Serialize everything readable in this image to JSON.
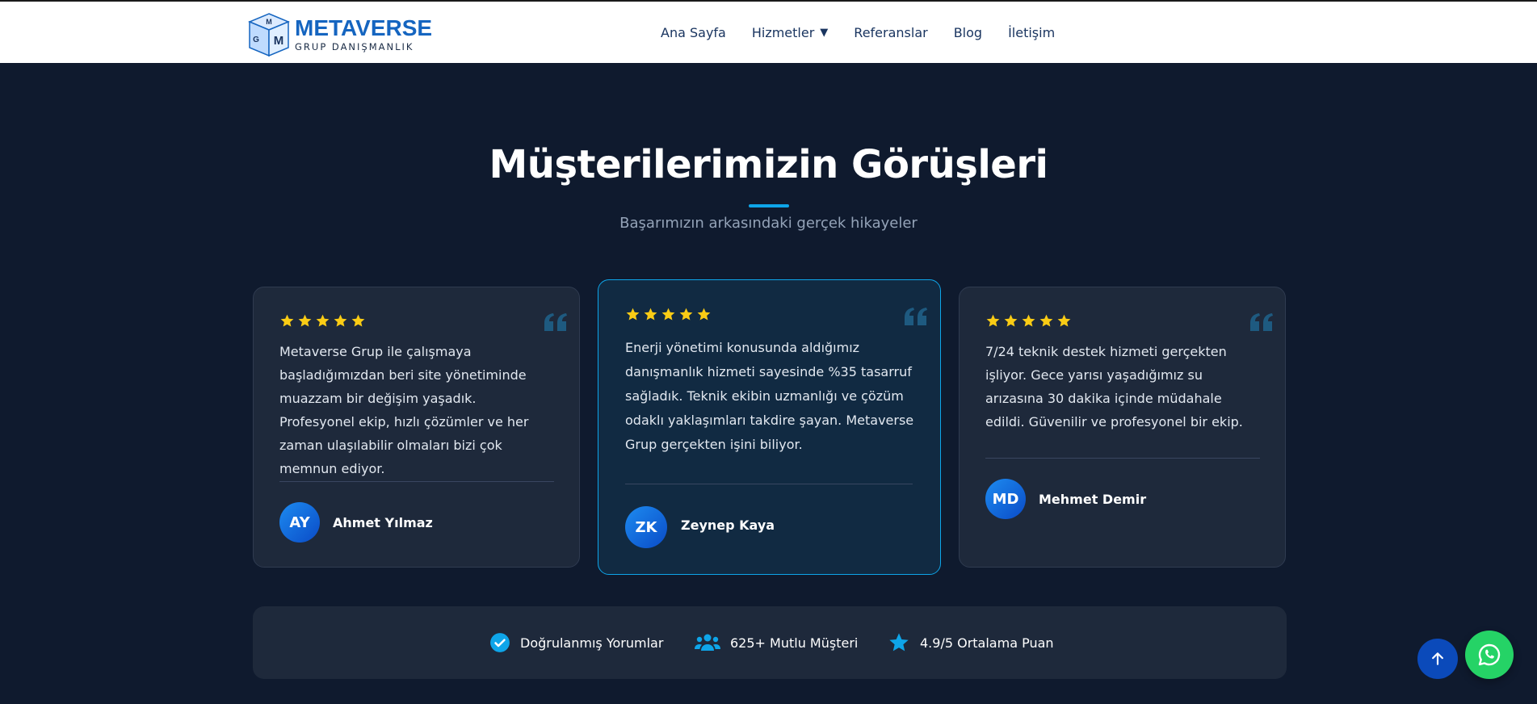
{
  "header": {
    "logo": {
      "title": "METAVERSE",
      "subtitle": "GRUP DANIŞMANLIK",
      "cube_letters": [
        "G",
        "M",
        "M"
      ]
    },
    "nav": [
      {
        "label": "Ana Sayfa"
      },
      {
        "label": "Hizmetler",
        "caret": "▼"
      },
      {
        "label": "Referanslar"
      },
      {
        "label": "Blog"
      },
      {
        "label": "İletişim"
      }
    ]
  },
  "section": {
    "title": "Müşterilerimizin Görüşleri",
    "subtitle": "Başarımızın arkasındaki gerçek hikayeler"
  },
  "testimonials": [
    {
      "rating": 5,
      "text": "Metaverse Grup ile çalışmaya başladığımızdan beri site yönetiminde muazzam bir değişim yaşadık. Profesyonel ekip, hızlı çözümler ve her zaman ulaşılabilir olmaları bizi çok memnun ediyor.",
      "initials": "AY",
      "name": "Ahmet Yılmaz"
    },
    {
      "rating": 5,
      "text": "Enerji yönetimi konusunda aldığımız danışmanlık hizmeti sayesinde %35 tasarruf sağladık. Teknik ekibin uzmanlığı ve çözüm odaklı yaklaşımları takdire şayan. Metaverse Grup gerçekten işini biliyor.",
      "initials": "ZK",
      "name": "Zeynep Kaya",
      "featured": true
    },
    {
      "rating": 5,
      "text": "7/24 teknik destek hizmeti gerçekten işliyor. Gece yarısı yaşadığımız su arızasına 30 dakika içinde müdahale edildi. Güvenilir ve profesyonel bir ekip.",
      "initials": "MD",
      "name": "Mehmet Demir"
    }
  ],
  "stats": [
    {
      "icon": "check-circle-icon",
      "label": "Doğrulanmış Yorumlar"
    },
    {
      "icon": "users-icon",
      "label": "625+ Mutlu Müşteri"
    },
    {
      "icon": "star-icon",
      "label": "4.9/5 Ortalama Puan"
    }
  ],
  "floating": {
    "back_to_top_icon": "arrow-up-icon",
    "whatsapp_icon": "whatsapp-icon"
  },
  "colors": {
    "background": "#0f1a2e",
    "card": "#1e293b",
    "accent": "#0ea5e9",
    "star": "#facc15",
    "brand": "#1565c0",
    "whatsapp": "#25d366"
  }
}
